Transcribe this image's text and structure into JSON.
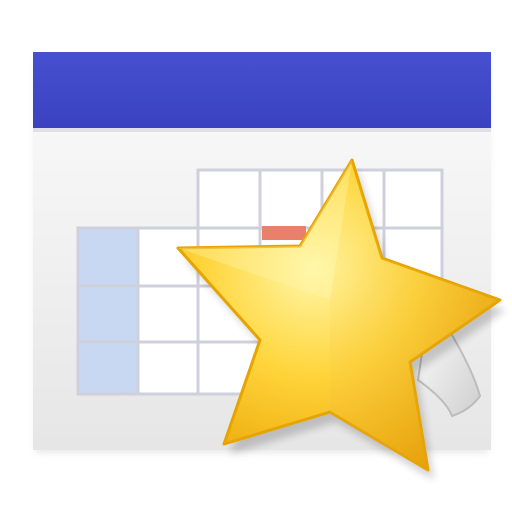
{
  "icon": {
    "name": "favorite-calendar-icon",
    "components": [
      "calendar-icon",
      "star-icon"
    ]
  },
  "colors": {
    "header": "#3f48c8",
    "page": "#f2f2f2",
    "grid_line": "#c9c9d9",
    "highlight_column": "#c9d8f2",
    "marked_cell": "#e8806a",
    "star_light": "#fff59a",
    "star_mid": "#ffd23a",
    "star_dark": "#e8a000"
  }
}
